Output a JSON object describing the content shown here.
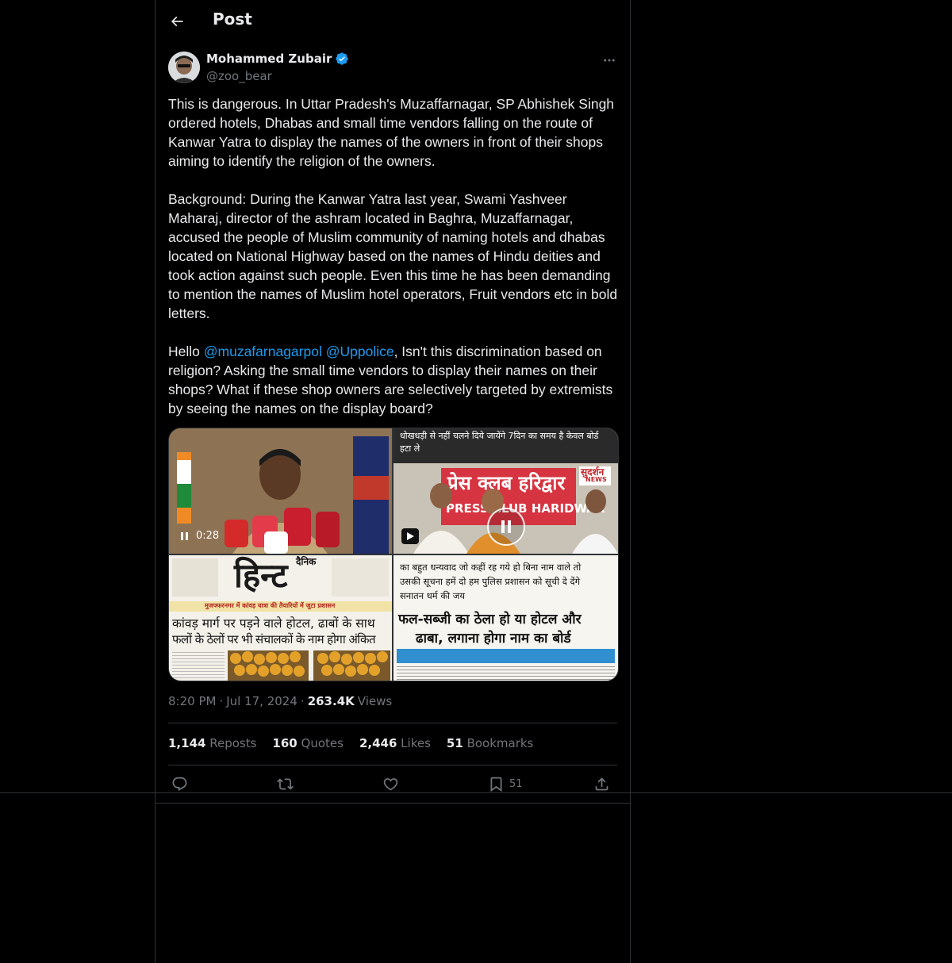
{
  "header": {
    "title": "Post"
  },
  "author": {
    "name": "Mohammed Zubair",
    "handle": "@zoo_bear",
    "verified": true
  },
  "post": {
    "paragraph1": "This is dangerous. In Uttar Pradesh's Muzaffarnagar, SP Abhishek Singh ordered hotels, Dhabas and small time vendors falling on the route of Kanwar Yatra to display the names of the owners in front of their shops aiming to identify the religion of the owners.",
    "paragraph2": "Background: During the Kanwar Yatra last year, Swami Yashveer Maharaj, director of the ashram located in Baghra, Muzaffarnagar, accused the people of Muslim community of naming hotels and dhabas located on National Highway based on the names of Hindu deities and took action against such people. Even this time he has been demanding to mention the names of Muslim hotel operators, Fruit vendors etc in bold letters.",
    "p3_prefix": "Hello ",
    "mention1": "@muzafarnagarpol",
    "mention2": "@Uppolice",
    "p3_suffix": ", Isn't this discrimination based on religion?  Asking the small time vendors to display their names on their shops? What if these shop owners are selectively targeted by extremists by seeing the names on the display board?"
  },
  "media": {
    "video1_time": "0:28",
    "video2_caption": "धोखधड़ी से नहीं चलने दिये जायेंगे 7दिन का समय है केवल बोर्ड हटा ले",
    "video2_banner": "प्रेस क्लब हरिद्वार",
    "video2_banner_sub": "PRESS CLUB HARIDWAR",
    "video2_logo": "सुदर्शन",
    "video2_logo_sub": "NEWS",
    "paper1_masthead": "हिन्ट",
    "paper1_masthead_small": "दैनिक",
    "paper1_tag": "मुजफ्फरनगर में कांवड़ यात्रा की तैयारियों में जुटा प्रशासन",
    "paper1_headline1": "कांवड़ मार्ग पर पड़ने वाले होटल, ढाबों के साथ",
    "paper1_headline2": "फलों के ठेलों पर भी संचालकों के नाम होगा अंकित",
    "paper2_text1": "का बहुत धन्यवाद जो कहीं रह गये हो बिना नाम वाले तो",
    "paper2_text2": "उसकी सूचना हमें दो हम पुलिस प्रशासन को सूची दे देंगे",
    "paper2_text3": "सनातन धर्म की जय",
    "paper2_headline1": "फल-सब्जी का ठेला हो या होटल और",
    "paper2_headline2": "ढाबा, लगाना होगा नाम का बोर्ड"
  },
  "meta": {
    "time": "8:20 PM",
    "date": "Jul 17, 2024",
    "views_count": "263.4K",
    "views_label": "Views"
  },
  "stats": {
    "reposts_count": "1,144",
    "reposts_label": "Reposts",
    "quotes_count": "160",
    "quotes_label": "Quotes",
    "likes_count": "2,446",
    "likes_label": "Likes",
    "bookmarks_count": "51",
    "bookmarks_label": "Bookmarks"
  },
  "actions": {
    "bookmark_count": "51"
  },
  "icons": [
    "back-arrow-icon",
    "verified-badge-icon",
    "more-icon",
    "pause-icon",
    "play-icon",
    "reply-icon",
    "repost-icon",
    "like-icon",
    "bookmark-icon",
    "share-icon"
  ],
  "colors": {
    "accent": "#1d9bf0",
    "muted": "#71767b",
    "text": "#e7e9ea",
    "background": "#000000"
  }
}
